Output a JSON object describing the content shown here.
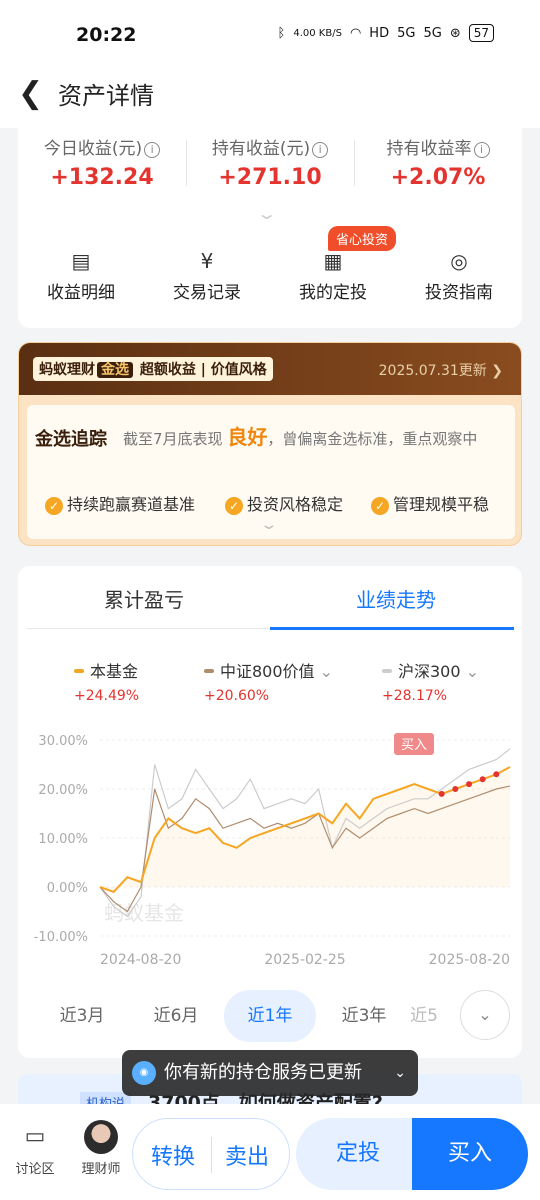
{
  "status_bar": {
    "time": "20:22",
    "net_speed": "4.00 KB/S",
    "signal1": "5G",
    "signal2": "5G",
    "hd": "HD",
    "battery": "57"
  },
  "nav": {
    "title": "资产详情"
  },
  "summary": {
    "stats": [
      {
        "label": "今日收益(元)",
        "value": "+132.24"
      },
      {
        "label": "持有收益(元)",
        "value": "+271.10"
      },
      {
        "label": "持有收益率",
        "value": "+2.07%"
      }
    ],
    "actions": [
      {
        "label": "收益明细",
        "icon": "document-icon"
      },
      {
        "label": "交易记录",
        "icon": "yen-icon"
      },
      {
        "label": "我的定投",
        "icon": "calendar-icon"
      },
      {
        "label": "投资指南",
        "icon": "compass-icon"
      }
    ],
    "tag": "省心投资"
  },
  "jinxuan": {
    "brand1": "蚂蚁理财",
    "brand2": "金选",
    "brand3": "超额收益",
    "brand4": "价值风格",
    "date": "2025.07.31更新",
    "title": "金选追踪",
    "desc_before": "截至7月底表现",
    "desc_highlight": "良好",
    "desc_after": "，曾偏离金选标准，重点观察中",
    "checks": [
      "持续跑赢赛道基准",
      "投资风格稳定",
      "管理规模平稳"
    ]
  },
  "perf": {
    "tabs": [
      "累计盈亏",
      "业绩走势"
    ],
    "active_tab": 1,
    "legend": [
      {
        "name": "本基金",
        "pct": "+24.49%",
        "color": "#f5a623",
        "dropdown": false
      },
      {
        "name": "中证800价值",
        "pct": "+20.60%",
        "color": "#b08d6e",
        "dropdown": true
      },
      {
        "name": "沪深300",
        "pct": "+28.17%",
        "color": "#cccccc",
        "dropdown": true
      }
    ],
    "periods": [
      "近3月",
      "近6月",
      "近1年",
      "近3年",
      "近5"
    ],
    "active_period": 2
  },
  "chart_data": {
    "type": "line",
    "title": "",
    "xlabel": "",
    "ylabel": "",
    "y_tick_labels": [
      "30.00%",
      "20.00%",
      "10.00%",
      "0.00%",
      "-10.00%"
    ],
    "ylim": [
      -10,
      30
    ],
    "x_tick_labels": [
      "2024-08-20",
      "2025-02-25",
      "2025-08-20"
    ],
    "watermark": "蚂蚁基金",
    "buy_label": "买入",
    "series": [
      {
        "name": "本基金",
        "color": "#f5a623",
        "values": [
          0,
          -1,
          2,
          1,
          10,
          14,
          12,
          11,
          12,
          9,
          8,
          10,
          11,
          12,
          13,
          14,
          15,
          13,
          17,
          14,
          18,
          19,
          20,
          21,
          20,
          19,
          20,
          21,
          22,
          23,
          24.5
        ]
      },
      {
        "name": "中证800价值",
        "color": "#b08d6e",
        "values": [
          0,
          -3,
          -5,
          0,
          20,
          12,
          14,
          18,
          16,
          12,
          13,
          14,
          12,
          13,
          12,
          13,
          15,
          8,
          12,
          10,
          12,
          14,
          15,
          16,
          15,
          16,
          17,
          18,
          19,
          20,
          20.6
        ]
      },
      {
        "name": "沪深300",
        "color": "#cccccc",
        "values": [
          0,
          -4,
          -6,
          -2,
          25,
          16,
          18,
          24,
          20,
          16,
          18,
          22,
          16,
          17,
          18,
          17,
          20,
          8,
          14,
          12,
          14,
          16,
          17,
          18,
          18,
          20,
          22,
          24,
          25,
          26,
          28.2
        ]
      }
    ]
  },
  "toast": {
    "text": "你有新的持仓服务已更新"
  },
  "strip": {
    "tag": "机构说",
    "text": "3700点，如何做资产配置?"
  },
  "bottom": {
    "discuss": "讨论区",
    "advisor": "理财师",
    "convert": "转换",
    "sell": "卖出",
    "auto_invest": "定投",
    "buy": "买入"
  }
}
